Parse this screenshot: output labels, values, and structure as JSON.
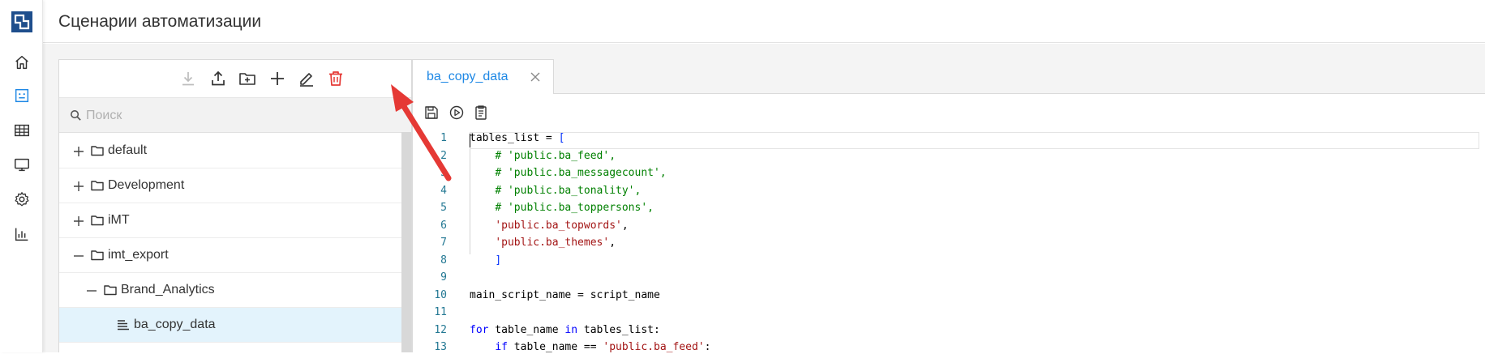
{
  "colors": {
    "accent": "#1e88e5",
    "delete": "#e53935",
    "annotation_arrow": "#e53935",
    "selected_row": "#e3f3fc",
    "logo": "#1e4e8c"
  },
  "nav": {
    "logo_icon": "app-logo-icon",
    "items": [
      {
        "icon": "home-icon"
      },
      {
        "icon": "scenarios-icon",
        "active": true
      },
      {
        "icon": "table-icon"
      },
      {
        "icon": "monitor-icon"
      },
      {
        "icon": "gear-icon"
      },
      {
        "icon": "bar-chart-icon"
      }
    ]
  },
  "header": {
    "title": "Сценарии автоматизации"
  },
  "tree_toolbar": {
    "buttons": [
      {
        "icon": "download-icon",
        "disabled": true
      },
      {
        "icon": "upload-icon"
      },
      {
        "icon": "folder-add-icon"
      },
      {
        "icon": "plus-icon"
      },
      {
        "icon": "edit-icon"
      },
      {
        "icon": "trash-icon"
      }
    ]
  },
  "search": {
    "placeholder": "Поиск",
    "value": ""
  },
  "tree": {
    "rows": [
      {
        "label": "default",
        "toggle": "+",
        "icon": "folder-icon",
        "level": 0
      },
      {
        "label": "Development",
        "toggle": "+",
        "icon": "folder-icon",
        "level": 0
      },
      {
        "label": "iMT",
        "toggle": "+",
        "icon": "folder-icon",
        "level": 0
      },
      {
        "label": "imt_export",
        "toggle": "−",
        "icon": "folder-icon",
        "level": 0
      },
      {
        "label": "Brand_Analytics",
        "toggle": "−",
        "icon": "folder-icon",
        "level": 1
      },
      {
        "label": "ba_copy_data",
        "toggle": "",
        "icon": "script-icon",
        "level": 2,
        "selected": true
      }
    ]
  },
  "editor": {
    "tab_label": "ba_copy_data",
    "tools": [
      "save-icon",
      "run-icon",
      "copy-script-icon"
    ],
    "lines": [
      {
        "n": "1",
        "tokens": [
          [
            "txt",
            "tables_list = "
          ],
          [
            "punc",
            "["
          ]
        ]
      },
      {
        "n": "2",
        "tokens": [
          [
            "txt",
            "    "
          ],
          [
            "com",
            "# 'public.ba_feed',"
          ]
        ]
      },
      {
        "n": "3",
        "tokens": [
          [
            "txt",
            "    "
          ],
          [
            "com",
            "# 'public.ba_messagecount',"
          ]
        ]
      },
      {
        "n": "4",
        "tokens": [
          [
            "txt",
            "    "
          ],
          [
            "com",
            "# 'public.ba_tonality',"
          ]
        ]
      },
      {
        "n": "5",
        "tokens": [
          [
            "txt",
            "    "
          ],
          [
            "com",
            "# 'public.ba_toppersons',"
          ]
        ]
      },
      {
        "n": "6",
        "tokens": [
          [
            "txt",
            "    "
          ],
          [
            "str",
            "'public.ba_topwords'"
          ],
          [
            "txt",
            ","
          ]
        ]
      },
      {
        "n": "7",
        "tokens": [
          [
            "txt",
            "    "
          ],
          [
            "str",
            "'public.ba_themes'"
          ],
          [
            "txt",
            ","
          ]
        ]
      },
      {
        "n": "8",
        "tokens": [
          [
            "txt",
            "    "
          ],
          [
            "punc",
            "]"
          ]
        ]
      },
      {
        "n": "9",
        "tokens": []
      },
      {
        "n": "10",
        "tokens": [
          [
            "txt",
            "main_script_name = script_name"
          ]
        ]
      },
      {
        "n": "11",
        "tokens": []
      },
      {
        "n": "12",
        "tokens": [
          [
            "kw",
            "for"
          ],
          [
            "txt",
            " table_name "
          ],
          [
            "kw",
            "in"
          ],
          [
            "txt",
            " tables_list:"
          ]
        ]
      },
      {
        "n": "13",
        "tokens": [
          [
            "txt",
            "    "
          ],
          [
            "kw",
            "if"
          ],
          [
            "txt",
            " table_name == "
          ],
          [
            "str",
            "'public.ba_feed'"
          ],
          [
            "txt",
            ":"
          ]
        ]
      }
    ]
  }
}
